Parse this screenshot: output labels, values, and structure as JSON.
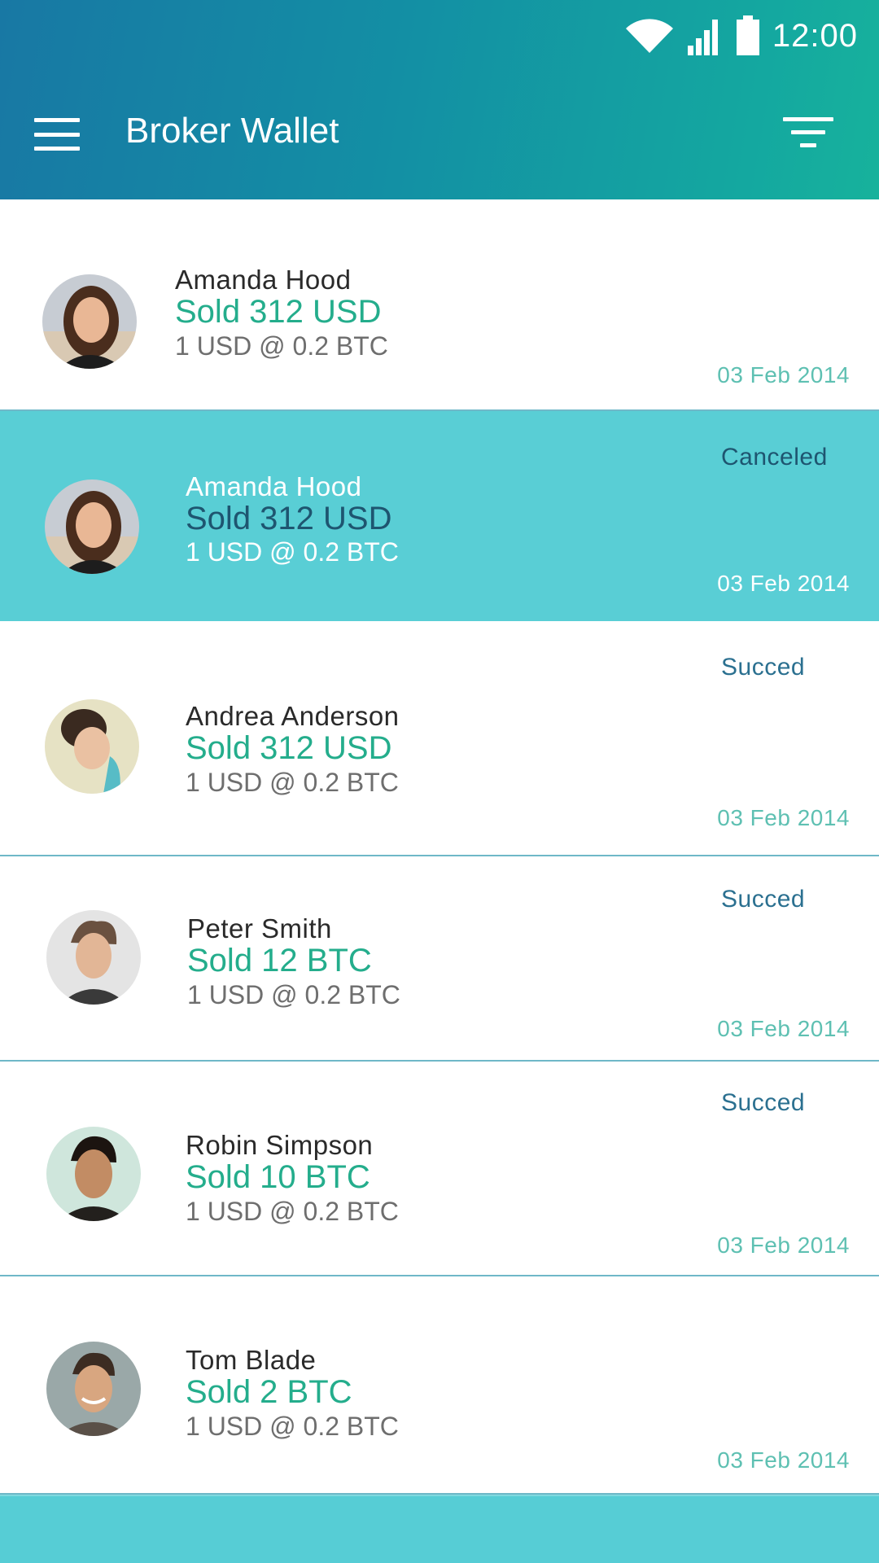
{
  "status_bar": {
    "time": "12:00",
    "icons": [
      "wifi-icon",
      "signal-icon",
      "battery-icon"
    ]
  },
  "app_bar": {
    "title": "Broker Wallet",
    "menu_icon": "menu-icon",
    "filter_icon": "filter-icon"
  },
  "colors": {
    "accent": "#24ad8c",
    "primary_dark": "#1878a4",
    "selected_row": "#59ced5",
    "status_text": "#2b7090"
  },
  "transactions": [
    {
      "name": "Amanda Hood",
      "amount": "Sold 312 USD",
      "rate": "1 USD @ 0.2 BTC",
      "status": "",
      "date": "03 Feb 2014",
      "selected": false
    },
    {
      "name": "Amanda Hood",
      "amount": "Sold 312 USD",
      "rate": "1 USD @ 0.2 BTC",
      "status": "Canceled",
      "date": "03 Feb 2014",
      "selected": true
    },
    {
      "name": "Andrea Anderson",
      "amount": "Sold 312 USD",
      "rate": "1 USD @ 0.2 BTC",
      "status": "Succed",
      "date": "03 Feb 2014",
      "selected": false
    },
    {
      "name": "Peter Smith",
      "amount": "Sold 12 BTC",
      "rate": "1 USD @ 0.2 BTC",
      "status": "Succed",
      "date": "03 Feb 2014",
      "selected": false
    },
    {
      "name": "Robin Simpson",
      "amount": "Sold 10 BTC",
      "rate": "1 USD @ 0.2 BTC",
      "status": "Succed",
      "date": "03 Feb 2014",
      "selected": false
    },
    {
      "name": "Tom Blade",
      "amount": "Sold 2 BTC",
      "rate": "1 USD @ 0.2 BTC",
      "status": "",
      "date": "03 Feb 2014",
      "selected": false
    }
  ]
}
